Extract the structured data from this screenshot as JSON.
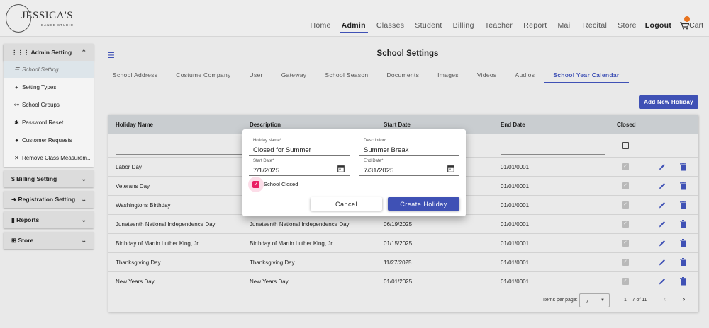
{
  "brand": {
    "name": "JESSICA'S",
    "subtitle": "DANCE STUDIO"
  },
  "nav": {
    "items": [
      "Home",
      "Admin",
      "Classes",
      "Student",
      "Billing",
      "Teacher",
      "Report",
      "Mail",
      "Recital",
      "Store"
    ],
    "active": "Admin",
    "logout": "Logout",
    "cart": "Cart"
  },
  "sidebar": {
    "admin": {
      "label": "Admin Setting",
      "items": [
        {
          "icon": "list-icon",
          "label": "School Setting"
        },
        {
          "icon": "plus-icon",
          "label": "Setting Types"
        },
        {
          "icon": "link-icon",
          "label": "School Groups"
        },
        {
          "icon": "gear-icon",
          "label": "Password Reset"
        },
        {
          "icon": "chat-icon",
          "label": "Customer Requests"
        },
        {
          "icon": "close-icon",
          "label": "Remove Class Measurem..."
        }
      ]
    },
    "billing": {
      "label": "Billing Setting"
    },
    "registration": {
      "label": "Registration Setting"
    },
    "reports": {
      "label": "Reports"
    },
    "store": {
      "label": "Store"
    }
  },
  "page": {
    "title": "School Settings",
    "tabs": [
      "School Address",
      "Costume Company",
      "User",
      "Gateway",
      "School Season",
      "Documents",
      "Images",
      "Videos",
      "Audios",
      "School Year Calendar"
    ],
    "active_tab": "School Year Calendar",
    "add_button": "Add New Holiday"
  },
  "table": {
    "columns": [
      "Holiday Name",
      "Description",
      "Start Date",
      "End Date",
      "Closed"
    ],
    "rows": [
      {
        "name": "Labor Day",
        "desc": "",
        "start": "",
        "end": "01/01/0001",
        "closed": true
      },
      {
        "name": "Veterans Day",
        "desc": "",
        "start": "",
        "end": "01/01/0001",
        "closed": true
      },
      {
        "name": "Washingtons Birthday",
        "desc": "",
        "start": "",
        "end": "01/01/0001",
        "closed": true
      },
      {
        "name": "Juneteenth National Independence Day",
        "desc": "Juneteenth National Independence Day",
        "start": "06/19/2025",
        "end": "01/01/0001",
        "closed": true
      },
      {
        "name": "Birthday of Martin Luther King, Jr",
        "desc": "Birthday of Martin Luther King, Jr",
        "start": "01/15/2025",
        "end": "01/01/0001",
        "closed": true
      },
      {
        "name": "Thanksgiving Day",
        "desc": "Thanksgiving Day",
        "start": "11/27/2025",
        "end": "01/01/0001",
        "closed": true
      },
      {
        "name": "New Years Day",
        "desc": "New Years Day",
        "start": "01/01/2025",
        "end": "01/01/0001",
        "closed": true
      }
    ],
    "pager": {
      "label": "Items per page:",
      "size": "7",
      "range": "1 – 7 of 11"
    }
  },
  "dialog": {
    "holiday_name": {
      "label": "Holiday Name*",
      "value": "Closed for Summer"
    },
    "description": {
      "label": "Description*",
      "value": "Summer Break"
    },
    "start_date": {
      "label": "Start Date*",
      "value": "7/1/2025"
    },
    "end_date": {
      "label": "End Date*",
      "value": "7/31/2025"
    },
    "closed_label": "School Closed",
    "closed": true,
    "cancel": "Cancel",
    "create": "Create Holiday"
  },
  "colors": {
    "primary": "#3f51b5",
    "checkbox_accent": "#e91e63",
    "cart_badge": "#e8731e"
  }
}
